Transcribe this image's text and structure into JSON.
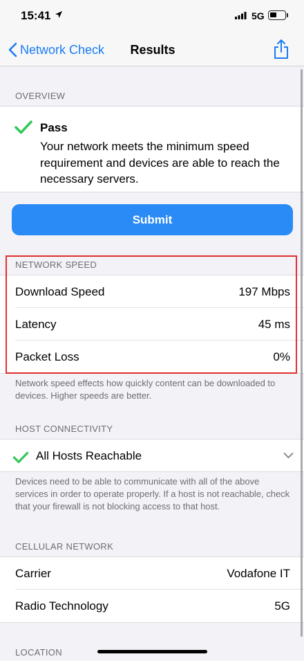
{
  "status_bar": {
    "time": "15:41",
    "network": "5G"
  },
  "nav": {
    "back_label": "Network Check",
    "title": "Results"
  },
  "overview": {
    "header": "OVERVIEW",
    "status": "Pass",
    "description": "Your network meets the minimum speed requirement and devices are able to reach the necessary servers."
  },
  "submit_label": "Submit",
  "network_speed": {
    "header": "NETWORK SPEED",
    "rows": [
      {
        "label": "Download Speed",
        "value": "197 Mbps"
      },
      {
        "label": "Latency",
        "value": "45 ms"
      },
      {
        "label": "Packet Loss",
        "value": "0%"
      }
    ],
    "footer": "Network speed effects how quickly content can be downloaded to devices. Higher speeds are better."
  },
  "host_connectivity": {
    "header": "HOST CONNECTIVITY",
    "status": "All Hosts Reachable",
    "footer": "Devices need to be able to communicate with all of the above services in order to operate properly. If a host is not reachable, check that your firewall is not blocking access to that host."
  },
  "cellular_network": {
    "header": "CELLULAR NETWORK",
    "rows": [
      {
        "label": "Carrier",
        "value": "Vodafone IT"
      },
      {
        "label": "Radio Technology",
        "value": "5G"
      }
    ]
  },
  "location": {
    "header": "LOCATION"
  },
  "colors": {
    "accent": "#2a8af6",
    "link": "#1a7cf5",
    "success": "#34c759",
    "highlight": "#e0302f"
  },
  "icons": {
    "location": "location-arrow-icon",
    "signal": "cellular-signal-icon",
    "battery": "battery-icon",
    "back": "chevron-left-icon",
    "share": "share-icon",
    "check": "checkmark-icon",
    "expand": "chevron-down-icon"
  }
}
